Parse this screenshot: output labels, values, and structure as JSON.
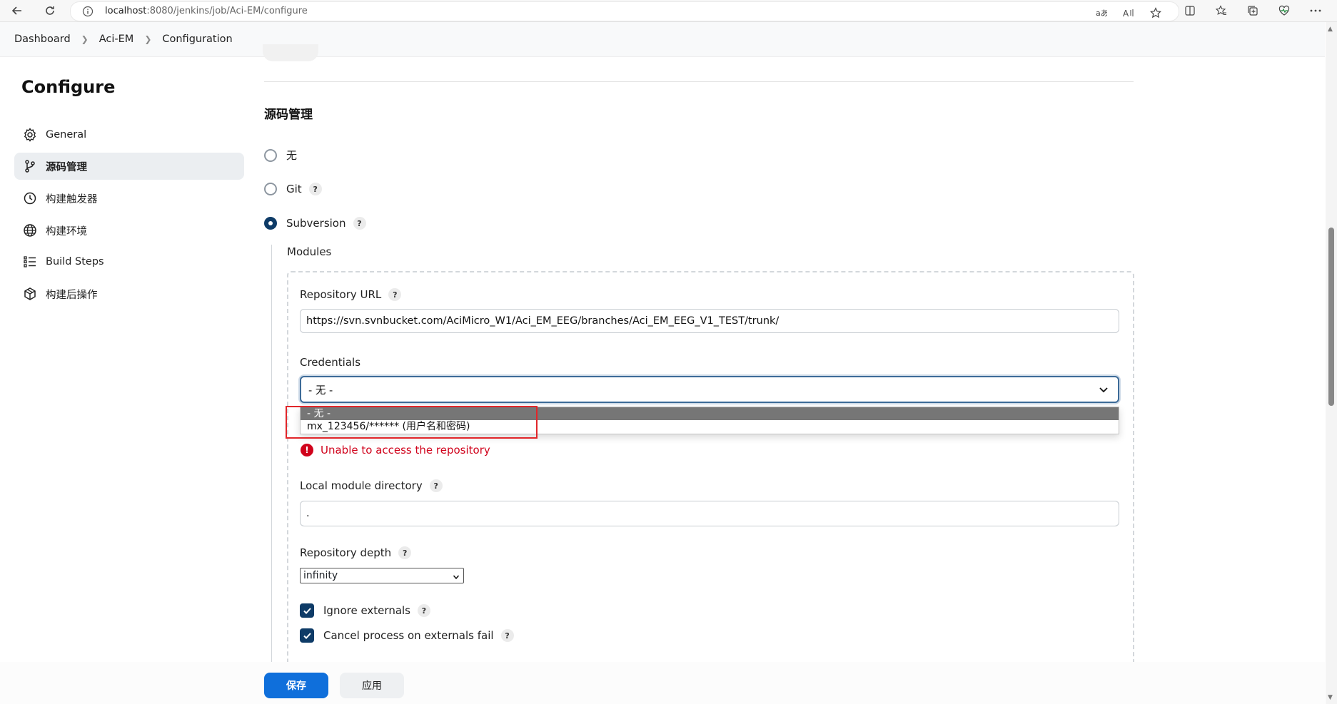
{
  "browser": {
    "url_host": "localhost",
    "url_rest": ":8080/jenkins/job/Aci-EM/configure"
  },
  "breadcrumb": [
    "Dashboard",
    "Aci-EM",
    "Configuration"
  ],
  "sidebar": {
    "title": "Configure",
    "items": [
      {
        "label": "General",
        "icon": "gear-icon"
      },
      {
        "label": "源码管理",
        "icon": "branch-icon"
      },
      {
        "label": "构建触发器",
        "icon": "clock-icon"
      },
      {
        "label": "构建环境",
        "icon": "globe-icon"
      },
      {
        "label": "Build Steps",
        "icon": "list-icon"
      },
      {
        "label": "构建后操作",
        "icon": "cube-icon"
      }
    ]
  },
  "main": {
    "section_title": "源码管理",
    "scm_options": [
      {
        "label": "无",
        "checked": false
      },
      {
        "label": "Git",
        "checked": false
      },
      {
        "label": "Subversion",
        "checked": true
      }
    ],
    "help_label": "?",
    "modules_label": "Modules",
    "repo_url_label": "Repository URL",
    "repo_url_value": "https://svn.svnbucket.com/AciMicro_W1/Aci_EM_EEG/branches/Aci_EM_EEG_V1_TEST/trunk/",
    "credentials_label": "Credentials",
    "credentials_value": "- 无 -",
    "credentials_options": [
      "- 无 -",
      "mx_123456/****** (用户名和密码)"
    ],
    "error_text": "Unable to access the repository",
    "error_icon_glyph": "!",
    "local_dir_label": "Local module directory",
    "local_dir_value": ".",
    "depth_label": "Repository depth",
    "depth_value": "infinity",
    "ignore_externals_label": "Ignore externals",
    "cancel_externals_label": "Cancel process on externals fail"
  },
  "footer": {
    "save_label": "保存",
    "apply_label": "应用"
  },
  "colors": {
    "primary": "#0f6fdb",
    "radio_checked": "#0e3b67",
    "error": "#d0021b",
    "highlight_box": "#e1262a"
  }
}
